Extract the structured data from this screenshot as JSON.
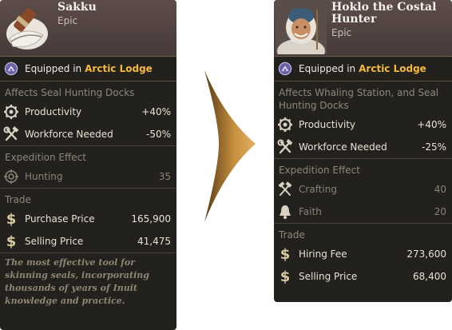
{
  "left": {
    "title": "Sakku",
    "rarity": "Epic",
    "equip_prefix": "Equipped in",
    "equip_place": "Arctic Lodge",
    "affects": "Affects Seal Hunting Docks",
    "stats": [
      {
        "label": "Productivity",
        "value": "+40%",
        "icon": "productivity-gear-icon"
      },
      {
        "label": "Workforce Needed",
        "value": "-50%",
        "icon": "hammer-wrench-icon"
      }
    ],
    "expedition_title": "Expedition Effect",
    "expedition": [
      {
        "label": "Hunting",
        "value": "35",
        "icon": "crosshair-icon"
      }
    ],
    "trade_title": "Trade",
    "trade": [
      {
        "label": "Purchase Price",
        "value": "165,900",
        "icon": "dollar-icon"
      },
      {
        "label": "Selling Price",
        "value": "41,475",
        "icon": "dollar-icon"
      }
    ],
    "flavor": "The most effective tool for skinning seals, incorporating thousands of years of Inuit knowledge and practice."
  },
  "right": {
    "title": "Hoklo the Costal Hunter",
    "rarity": "Epic",
    "equip_prefix": "Equipped in",
    "equip_place": "Arctic Lodge",
    "affects": "Affects Whaling Station, and Seal Hunting Docks",
    "stats": [
      {
        "label": "Productivity",
        "value": "+40%",
        "icon": "productivity-gear-icon"
      },
      {
        "label": "Workforce Needed",
        "value": "-25%",
        "icon": "hammer-wrench-icon"
      }
    ],
    "expedition_title": "Expedition Effect",
    "expedition": [
      {
        "label": "Crafting",
        "value": "40",
        "icon": "crossed-hammers-icon"
      },
      {
        "label": "Faith",
        "value": "20",
        "icon": "bell-icon"
      }
    ],
    "trade_title": "Trade",
    "trade": [
      {
        "label": "Hiring Fee",
        "value": "273,600",
        "icon": "dollar-icon"
      },
      {
        "label": "Selling Price",
        "value": "68,400",
        "icon": "dollar-icon"
      }
    ]
  },
  "colors": {
    "accent": "#f5b93a",
    "arrow": "#c8923f",
    "panel": "#23211e"
  }
}
